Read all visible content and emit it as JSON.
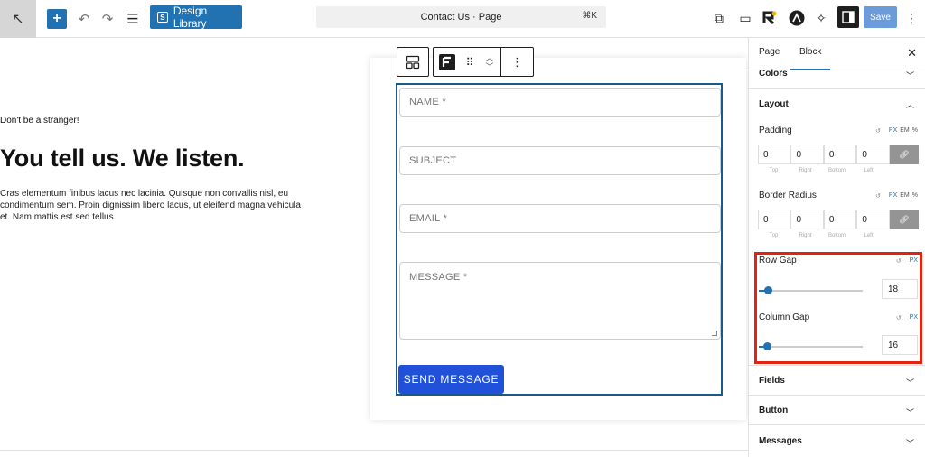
{
  "topbar": {
    "design_library_label": "Design Library",
    "document_title": "Contact Us · Page",
    "shortcut": "⌘K",
    "save_label": "Save"
  },
  "intro": {
    "kicker": "Don't be a stranger!",
    "title": "You tell us. We listen.",
    "body": "Cras elementum finibus lacus nec lacinia. Quisque non convallis nisl, eu condimentum sem. Proin dignissim libero lacus, ut eleifend magna vehicula et. Nam mattis est sed tellus."
  },
  "form": {
    "name_placeholder": "NAME *",
    "subject_placeholder": "SUBJECT",
    "email_placeholder": "EMAIL *",
    "message_placeholder": "MESSAGE *",
    "submit_label": "SEND MESSAGE"
  },
  "sidebar": {
    "tab_page": "Page",
    "tab_block": "Block",
    "colors": "Colors",
    "layout": "Layout",
    "padding": {
      "label": "Padding",
      "values": [
        "0",
        "0",
        "0",
        "0"
      ],
      "sides": [
        "Top",
        "Right",
        "Bottom",
        "Left"
      ],
      "units": [
        "PX",
        "EM",
        "%"
      ]
    },
    "border_radius": {
      "label": "Border Radius",
      "values": [
        "0",
        "0",
        "0",
        "0"
      ],
      "sides": [
        "Top",
        "Right",
        "Bottom",
        "Left"
      ],
      "units": [
        "PX",
        "EM",
        "%"
      ]
    },
    "row_gap": {
      "label": "Row Gap",
      "unit": "PX",
      "value": "18"
    },
    "column_gap": {
      "label": "Column Gap",
      "unit": "PX",
      "value": "16"
    },
    "fields": "Fields",
    "button": "Button",
    "messages": "Messages"
  },
  "colors": {
    "accent": "#2271b1",
    "submit": "#2051d8",
    "highlight": "#e3220f"
  }
}
